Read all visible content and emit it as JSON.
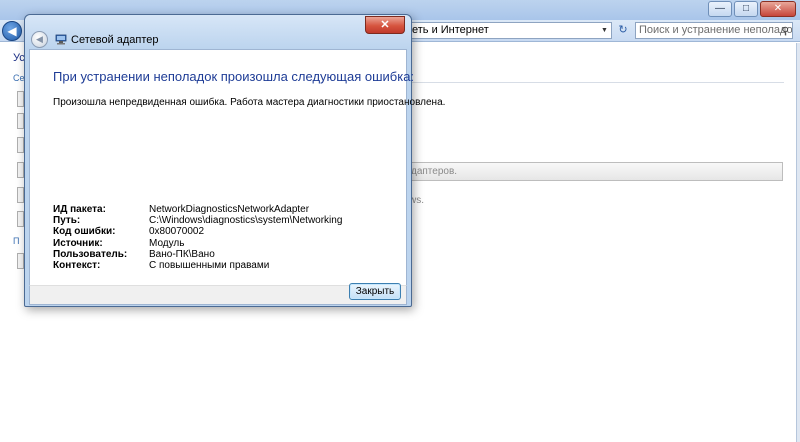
{
  "background": {
    "address_text": "еть и Интернет",
    "search_placeholder": "Поиск и устранение неполадок",
    "left_text_1": "Ус",
    "left_text_2": "Се",
    "left_text_3": "П",
    "progress_text": "даптеров.",
    "body_text": "ws.",
    "controls": {
      "minimize": "—",
      "maximize": "□",
      "close": "✕"
    },
    "back_glyph": "◀",
    "refresh_glyph": "↻",
    "dropdown_glyph": "▼",
    "search_glyph": "⚲"
  },
  "dialog": {
    "title": "Сетевой адаптер",
    "close_glyph": "✕",
    "back_glyph": "◀",
    "heading": "При устранении неполадок произошла следующая ошибка:",
    "message": "Произошла непредвиденная ошибка. Работа мастера диагностики приостановлена.",
    "details": [
      {
        "label": "ИД пакета:",
        "value": "NetworkDiagnosticsNetworkAdapter"
      },
      {
        "label": "Путь:",
        "value": "C:\\Windows\\diagnostics\\system\\Networking"
      },
      {
        "label": "Код ошибки:",
        "value": "0x80070002"
      },
      {
        "label": "Источник:",
        "value": "Модуль"
      },
      {
        "label": "Пользователь:",
        "value": "Вано-ПК\\Вано"
      },
      {
        "label": "Контекст:",
        "value": "С повышенными правами"
      }
    ],
    "close_button_label": "Закрыть"
  },
  "colors": {
    "heading_blue": "#1e3c96",
    "frame_blue": "#bcd4ee",
    "close_red": "#c0392b"
  }
}
